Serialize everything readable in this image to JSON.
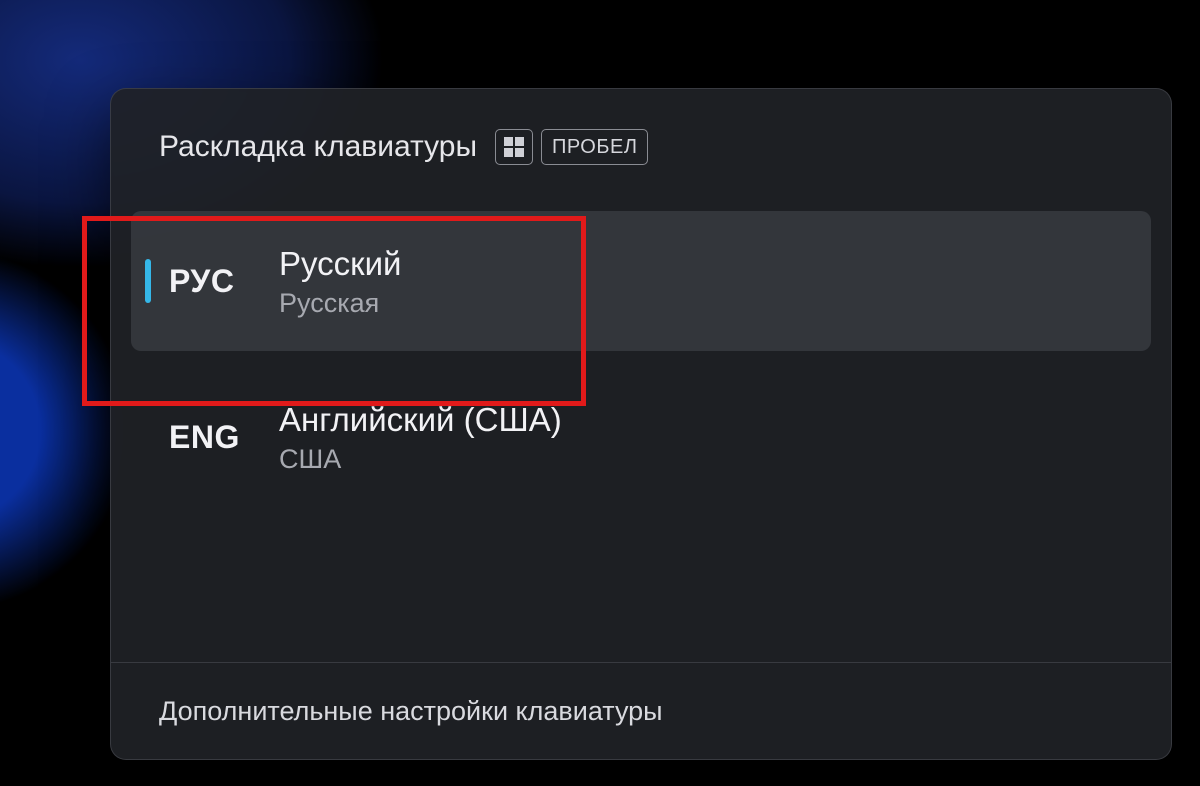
{
  "header": {
    "title": "Раскладка клавиатуры",
    "shortcut_key_label": "ПРОБЕЛ"
  },
  "layouts": [
    {
      "code": "РУС",
      "name": "Русский",
      "layout": "Русская",
      "selected": true
    },
    {
      "code": "ENG",
      "name": "Английский (США)",
      "layout": "США",
      "selected": false
    }
  ],
  "footer": {
    "more_settings": "Дополнительные настройки клавиатуры"
  },
  "annotation": {
    "highlight_color": "#e11a1a"
  }
}
